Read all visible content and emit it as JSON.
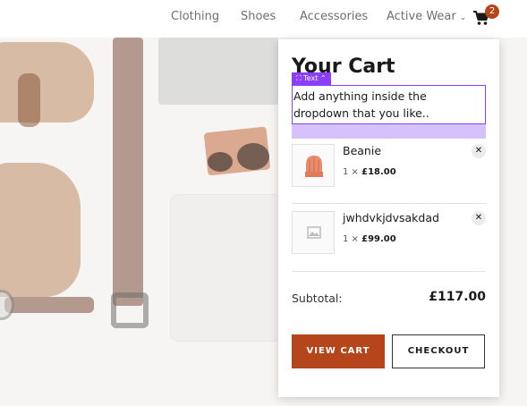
{
  "nav": {
    "items": [
      {
        "label": "Clothing"
      },
      {
        "label": "Shoes"
      },
      {
        "label": "Accessories"
      },
      {
        "label": "Active Wear"
      }
    ],
    "cart_count": "2",
    "cart_icon": "cart-icon"
  },
  "cart": {
    "title": "Your Cart",
    "text_tag": "Text",
    "custom_text": "Add anything inside the dropdown that you like..",
    "items": [
      {
        "name": "Beanie",
        "qty": "1 ×",
        "price": "£18.00",
        "thumb_icon": "beanie-icon"
      },
      {
        "name": "jwhdvkjdvsakdad",
        "qty": "1 ×",
        "price": "£99.00",
        "thumb_icon": "image-placeholder-icon"
      }
    ],
    "subtotal_label": "Subtotal:",
    "subtotal_value": "£117.00",
    "view_cart_label": "VIEW CART",
    "checkout_label": "CHECKOUT"
  },
  "colors": {
    "accent": "#b5451b",
    "editor_purple": "#8a3ffc",
    "editor_band": "#d7c1fc"
  }
}
